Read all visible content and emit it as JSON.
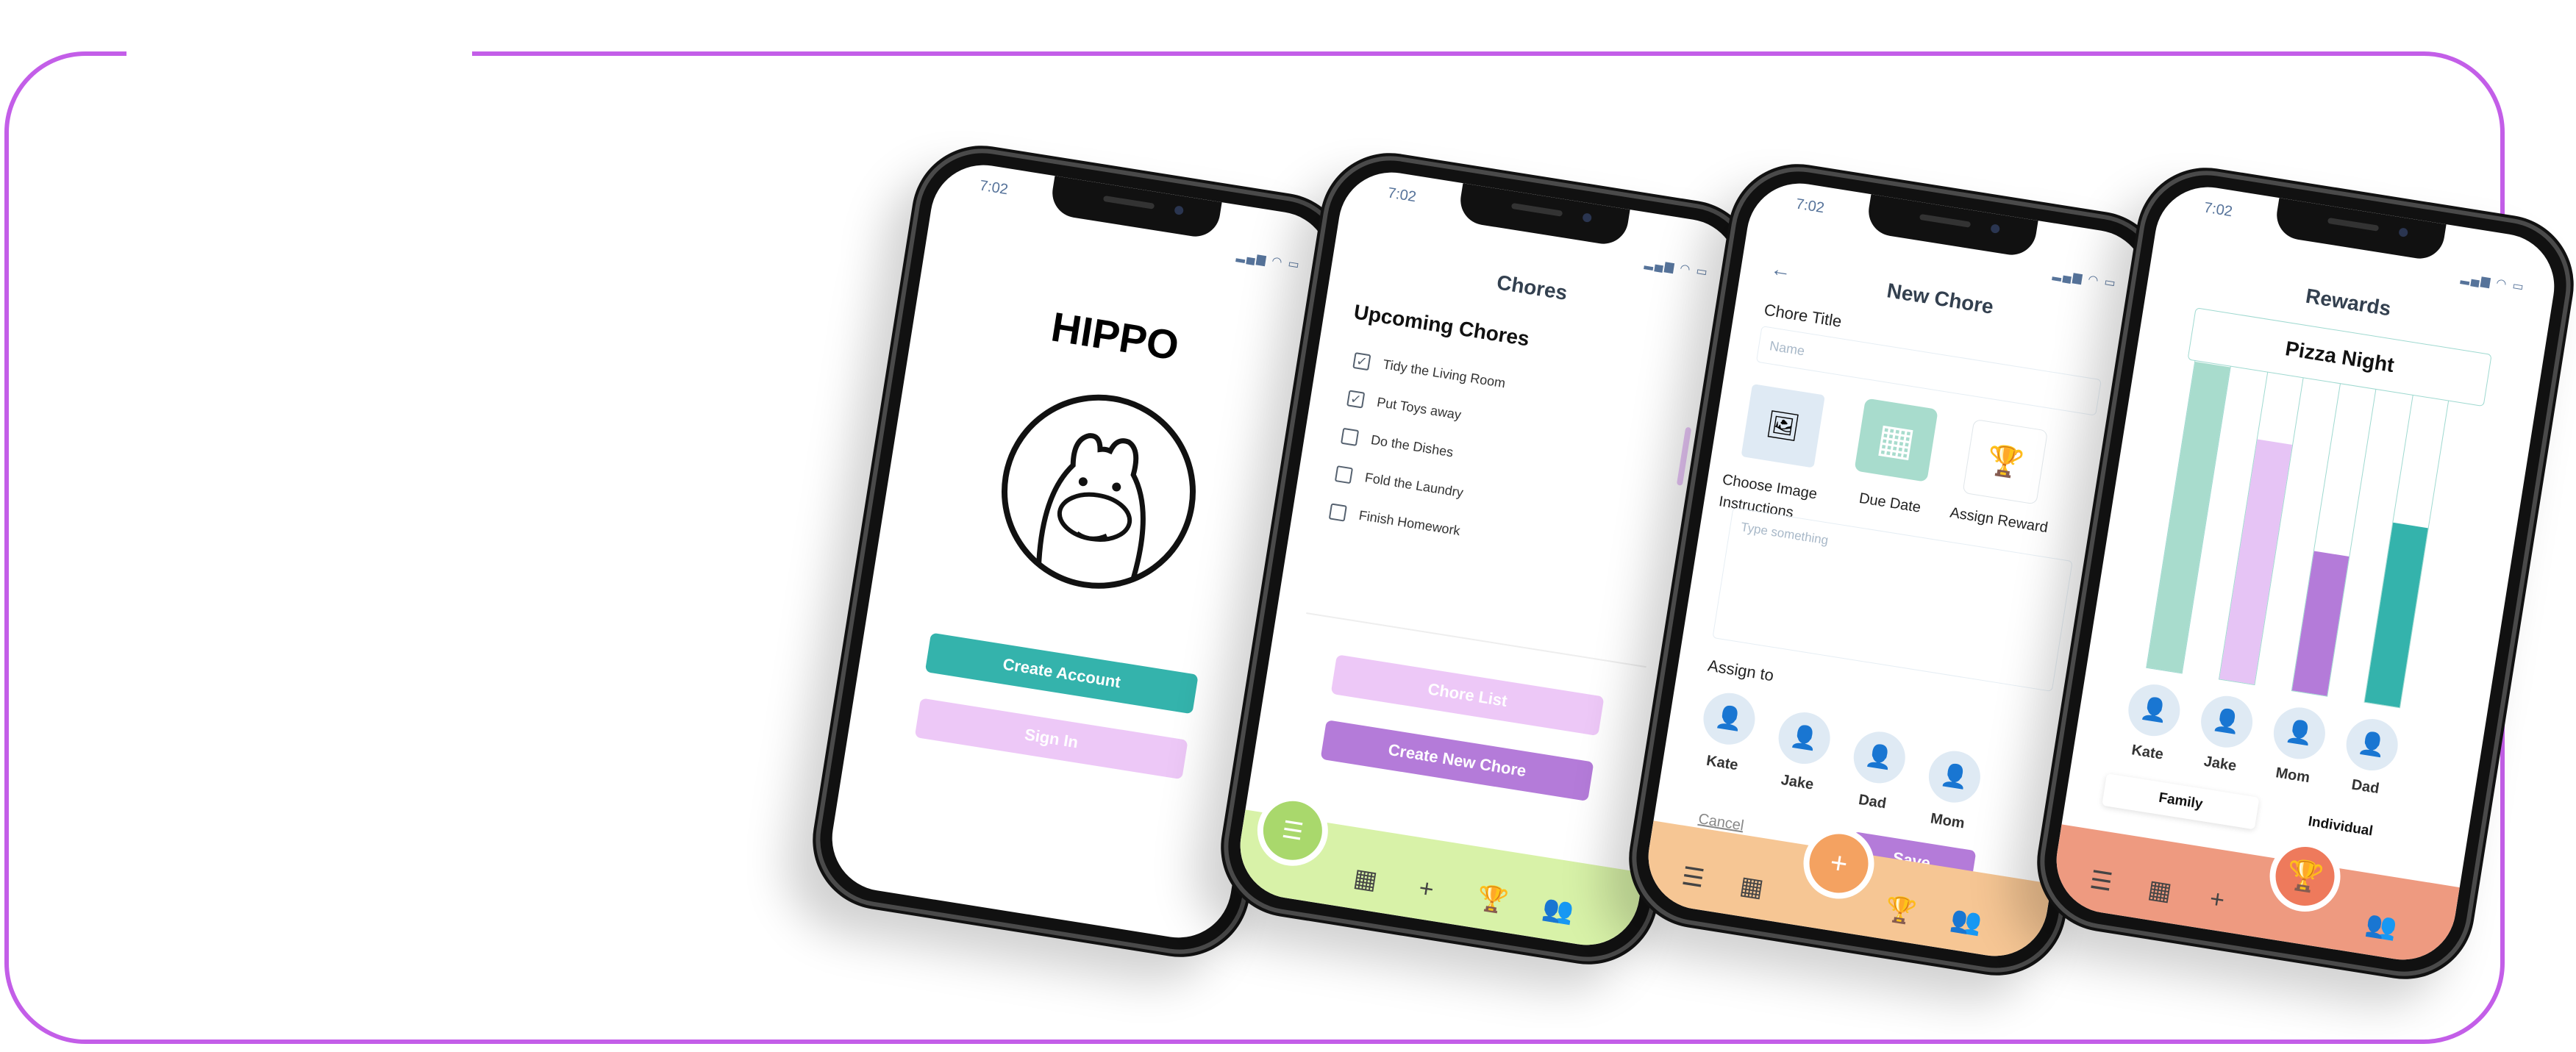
{
  "brand_color": "#c35ee8",
  "status_time": "7:02",
  "status_icons": "signal wifi battery",
  "login": {
    "app_name": "HIPPO",
    "create_account": "Create Account",
    "sign_in": "Sign In",
    "primary_color": "#34b3ac",
    "secondary_color": "#edc8f7"
  },
  "chores": {
    "title": "Chores",
    "section": "Upcoming Chores",
    "items": [
      {
        "label": "Tidy the Living Room",
        "checked": true
      },
      {
        "label": "Put Toys away",
        "checked": true
      },
      {
        "label": "Do the Dishes",
        "checked": false
      },
      {
        "label": "Fold the Laundry",
        "checked": false
      },
      {
        "label": "Finish Homework",
        "checked": false
      }
    ],
    "chore_list": "Chore List",
    "create_new": "Create New Chore",
    "nav_color": "#d8f2a8"
  },
  "new_chore": {
    "back": "←",
    "title": "New Chore",
    "chore_title_label": "Chore Title",
    "name_placeholder": "Name",
    "choose_image": "Choose Image",
    "instructions": "Instructions",
    "due_date": "Due Date",
    "assign_reward": "Assign Reward",
    "type_placeholder": "Type something",
    "assign_to": "Assign to",
    "people": [
      "Kate",
      "Jake",
      "Dad",
      "Mom"
    ],
    "cancel": "Cancel",
    "save": "Save",
    "nav_color": "#f6c694",
    "accent": "#f4a261"
  },
  "rewards": {
    "title": "Rewards",
    "reward_name": "Pizza Night",
    "people": [
      "Kate",
      "Jake",
      "Mom",
      "Dad"
    ],
    "progress": [
      0.92,
      0.72,
      0.42,
      0.54
    ],
    "progress_colors": [
      "#a8dccd",
      "#e6c4f5",
      "#b47bd9",
      "#34b3ac"
    ],
    "tab_family": "Family",
    "tab_individual": "Individual",
    "nav_color": "#ee9a80"
  },
  "icons": {
    "list": "☰",
    "calendar": "▦",
    "plus": "+",
    "trophy": "🏆",
    "people": "👥",
    "person": "👤",
    "image": "🖼"
  }
}
